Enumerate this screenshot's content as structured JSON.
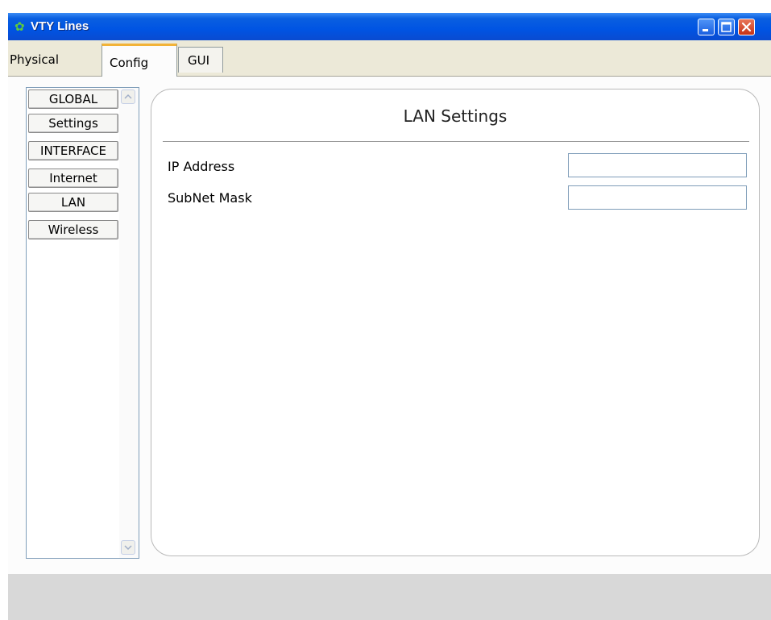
{
  "window": {
    "title": "VTY Lines",
    "app_icon": "packet-tracer-app-icon",
    "buttons": [
      "minimize-icon",
      "maximize-icon",
      "close-icon"
    ]
  },
  "tabs": [
    {
      "label": "Physical",
      "active": false
    },
    {
      "label": "Config",
      "active": true
    },
    {
      "label": "GUI",
      "active": false
    }
  ],
  "sidebar": {
    "items": [
      {
        "label": "GLOBAL"
      },
      {
        "label": "Settings"
      },
      {
        "label": "INTERFACE"
      },
      {
        "label": "Internet"
      },
      {
        "label": "LAN"
      },
      {
        "label": "Wireless"
      }
    ]
  },
  "panel": {
    "title": "LAN Settings",
    "fields": [
      {
        "label": "IP Address",
        "value": ""
      },
      {
        "label": "SubNet Mask",
        "value": ""
      }
    ]
  },
  "colors": {
    "titlebar": "#0054e3",
    "active_tab_accent": "#f2b338",
    "window_bg": "#ece9d8",
    "close_button": "#c83214"
  }
}
